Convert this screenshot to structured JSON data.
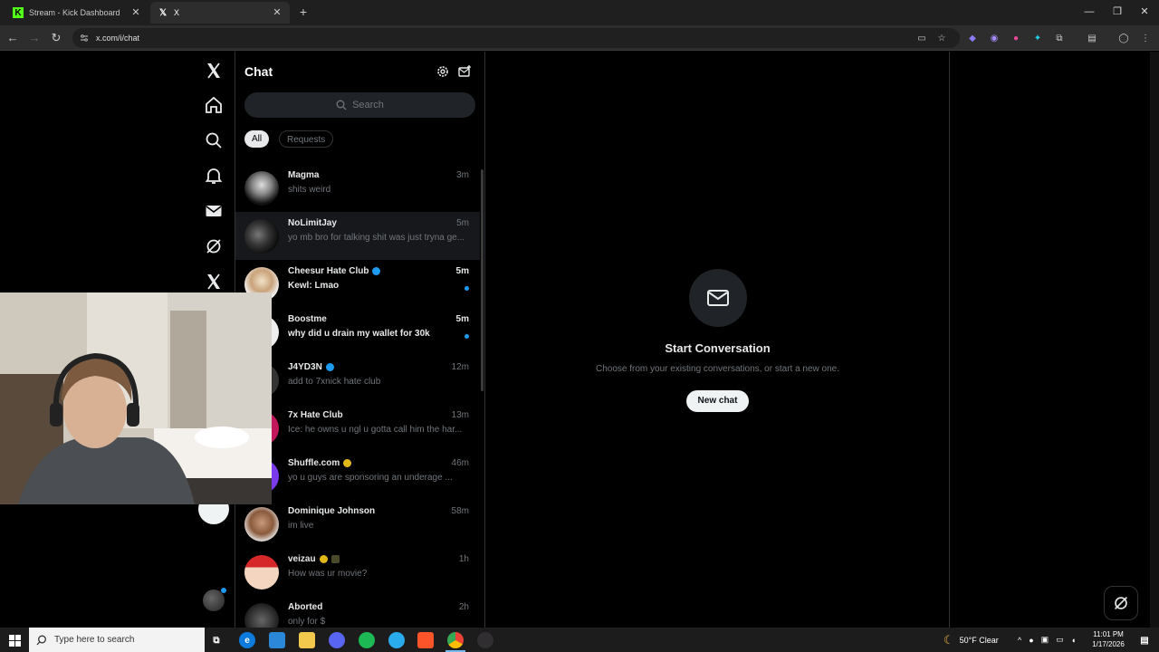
{
  "browser": {
    "tabs": [
      {
        "title": "Stream - Kick Dashboard",
        "favicon": "kick-icon"
      },
      {
        "title": "X",
        "favicon": "x-logo-icon"
      }
    ],
    "url": "x.com/i/chat"
  },
  "chat": {
    "title": "Chat",
    "search_placeholder": "Search",
    "filters": [
      "All",
      "Requests"
    ],
    "conversations": [
      {
        "name": "Magma",
        "preview": "shits weird",
        "time": "3m",
        "unread": false,
        "badge": ""
      },
      {
        "name": "NoLimitJay",
        "preview": "yo mb bro for talking shit was just tryna ge...",
        "time": "5m",
        "unread": false,
        "badge": ""
      },
      {
        "name": "Cheesur Hate Club",
        "preview": "Kewl: Lmao",
        "time": "5m",
        "unread": true,
        "badge": "#1d9bf0"
      },
      {
        "name": "Boostme",
        "preview": "why did u drain my wallet for 30k",
        "time": "5m",
        "unread": true,
        "badge": ""
      },
      {
        "name": "J4YD3N",
        "preview": "add to 7xnick hate club",
        "time": "12m",
        "unread": false,
        "badge": "#1d9bf0"
      },
      {
        "name": "7x Hate Club",
        "preview": "Ice: he owns u ngl u gotta call him the har...",
        "time": "13m",
        "unread": false,
        "badge": ""
      },
      {
        "name": "Shuffle.com",
        "preview": "yo u guys are sponsoring an underage ...",
        "time": "46m",
        "unread": false,
        "badge": "#e2b719"
      },
      {
        "name": "Dominique Johnson",
        "preview": "im live",
        "time": "58m",
        "unread": false,
        "badge": ""
      },
      {
        "name": "veizau",
        "preview": "How was ur movie?",
        "time": "1h",
        "unread": false,
        "badge": "#e2b719"
      },
      {
        "name": "Aborted",
        "preview": "only for $",
        "time": "2h",
        "unread": false,
        "badge": ""
      }
    ]
  },
  "empty_state": {
    "title": "Start Conversation",
    "subtitle": "Choose from your existing conversations, or start a new one.",
    "button": "New chat"
  },
  "taskbar": {
    "search_placeholder": "Type here to search",
    "weather": "50°F  Clear",
    "time": "11:01 PM",
    "date": "1/17/2026"
  }
}
